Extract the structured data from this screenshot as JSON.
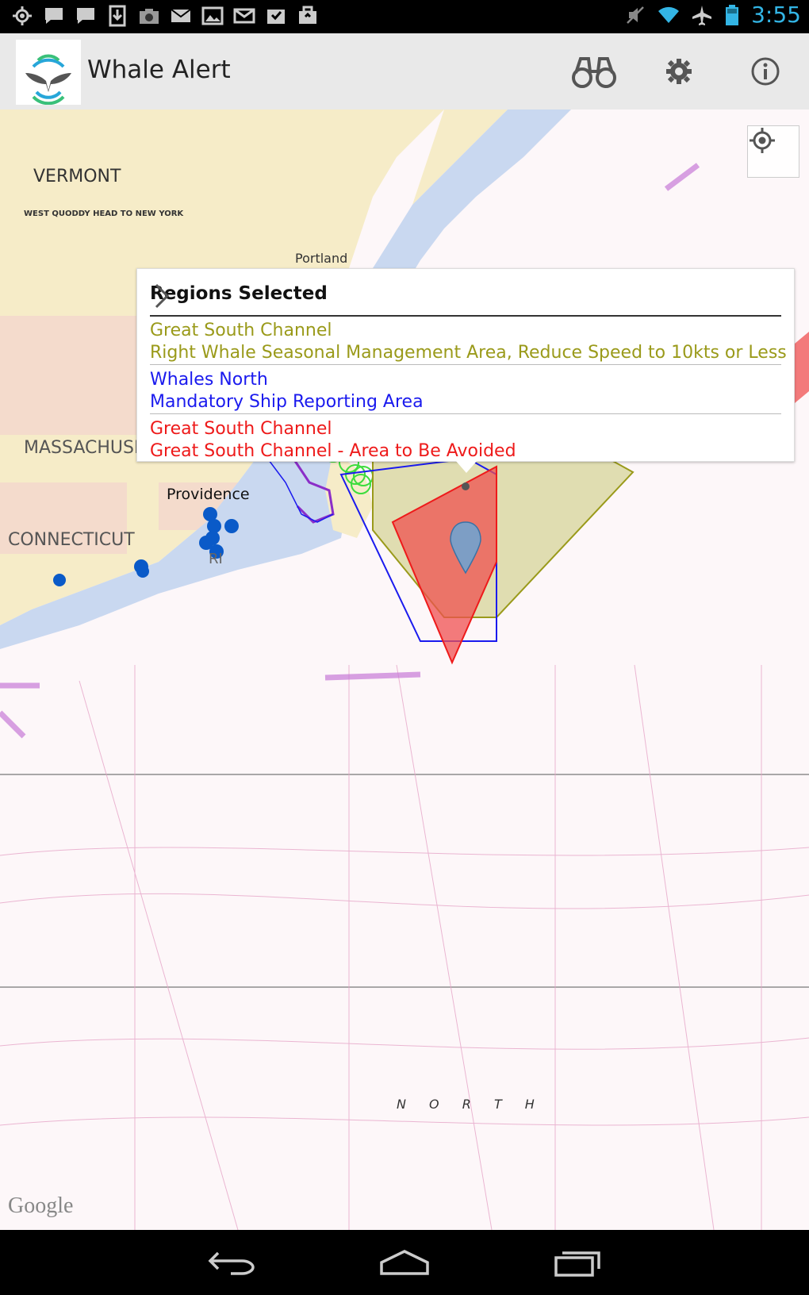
{
  "status_bar": {
    "time": "3:55",
    "notification_icons": [
      "gps-icon",
      "chat-icon",
      "chat-icon",
      "download-icon",
      "camera-icon",
      "mail-icon",
      "image-icon",
      "gmail-icon",
      "inbox-icon",
      "briefcase-icon"
    ],
    "system_icons": [
      "mute-icon",
      "wifi-icon",
      "airplane-icon",
      "battery-icon"
    ]
  },
  "action_bar": {
    "title": "Whale Alert",
    "actions": [
      "binoculars-icon",
      "settings-icon",
      "info-icon"
    ]
  },
  "map": {
    "labels": {
      "vermont": "VERMONT",
      "chart_title": "WEST QUODDY HEAD TO NEW YORK",
      "portland": "Portland",
      "massachusetts": "MASSACHUSETTS",
      "providence": "Providence",
      "connecticut": "CONNECTICUT",
      "ri": "RI",
      "north": "N O R T H"
    },
    "attribution": "Google"
  },
  "popup": {
    "title": "Regions Selected",
    "regions": [
      {
        "name": "Great South Channel",
        "description": "Right Whale Seasonal Management Area, Reduce Speed to 10kts or Less",
        "color": "#9a9a1a"
      },
      {
        "name": "Whales North",
        "description": "Mandatory Ship Reporting Area",
        "color": "#1a1aee"
      },
      {
        "name": "Great South Channel",
        "description": "Great South Channel - Area to Be Avoided",
        "color": "#ee1a1a"
      }
    ]
  },
  "nav_bar": [
    "back-icon",
    "home-icon",
    "recent-apps-icon"
  ]
}
